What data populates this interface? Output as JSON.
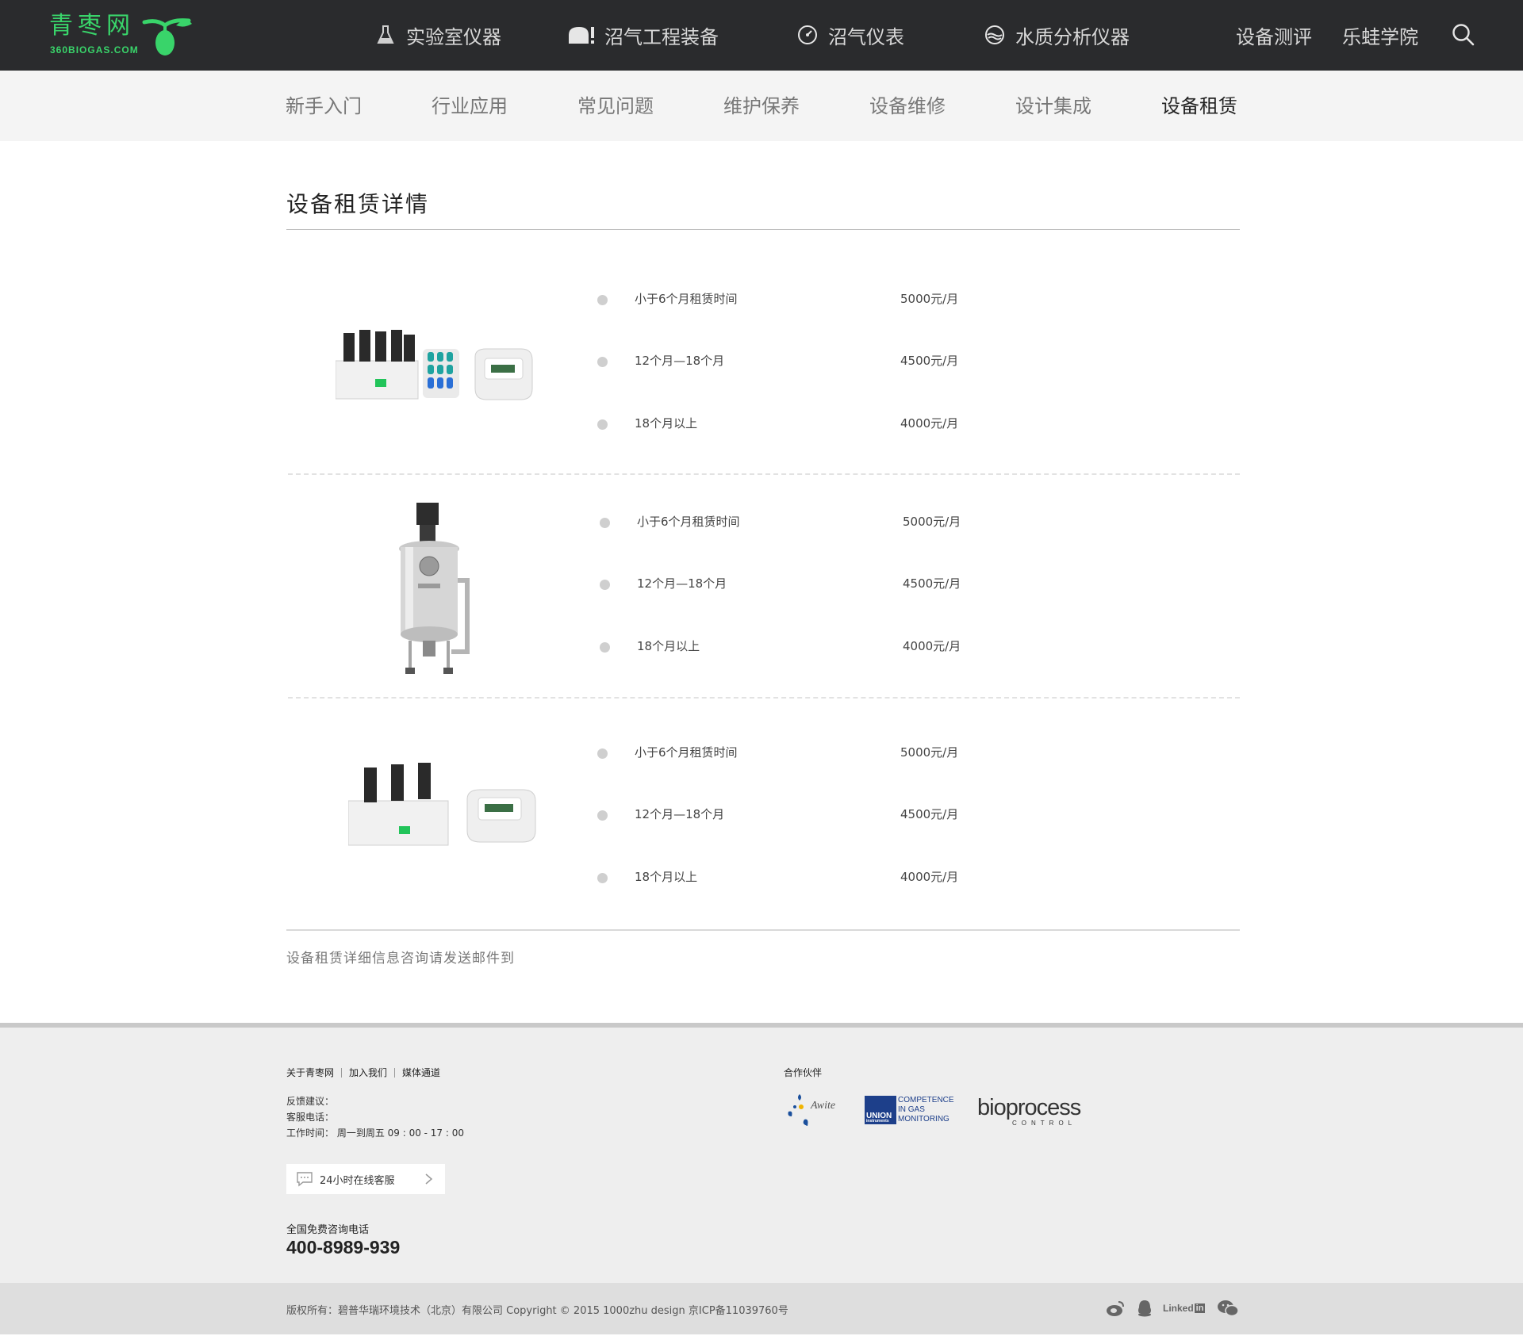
{
  "brand": {
    "name_cn": "青枣网",
    "domain": "360BIOGAS.COM",
    "color": "#39d46a"
  },
  "header": {
    "nav": [
      {
        "label": "实验室仪器",
        "icon": "flask-icon"
      },
      {
        "label": "沼气工程装备",
        "icon": "tank-icon"
      },
      {
        "label": "沼气仪表",
        "icon": "gauge-icon"
      },
      {
        "label": "水质分析仪器",
        "icon": "water-icon"
      }
    ],
    "right_links": [
      "设备测评",
      "乐蛙学院"
    ],
    "search_icon": "search-icon"
  },
  "subnav": {
    "items": [
      "新手入门",
      "行业应用",
      "常见问题",
      "维护保养",
      "设备维修",
      "设计集成",
      "设备租赁"
    ],
    "active_index": 6
  },
  "main": {
    "title": "设备租赁详情",
    "products": [
      {
        "image": "multi-reactor-test-system",
        "rates": [
          {
            "label": "小于6个月租赁时间",
            "price": "5000元/月"
          },
          {
            "label": "12个月—18个月",
            "price": "4500元/月"
          },
          {
            "label": "18个月以上",
            "price": "4000元/月"
          }
        ]
      },
      {
        "image": "stainless-fermenter",
        "rates": [
          {
            "label": "小于6个月租赁时间",
            "price": "5000元/月"
          },
          {
            "label": "12个月—18个月",
            "price": "4500元/月"
          },
          {
            "label": "18个月以上",
            "price": "4000元/月"
          }
        ]
      },
      {
        "image": "three-reactor-test-system",
        "rates": [
          {
            "label": "小于6个月租赁时间",
            "price": "5000元/月"
          },
          {
            "label": "12个月—18个月",
            "price": "4500元/月"
          },
          {
            "label": "18个月以上",
            "price": "4000元/月"
          }
        ]
      }
    ],
    "contact_note": "设备租赁详细信息咨询请发送邮件到"
  },
  "footer": {
    "links": [
      "关于青枣网",
      "加入我们",
      "媒体通道"
    ],
    "feedback_label": "反馈建议：",
    "service_phone_label": "客服电话：",
    "work_hours": "工作时间： 周一到周五 09 : 00 - 17 : 00",
    "chat_button": "24小时在线客服",
    "hotline_label": "全国免费咨询电话",
    "hotline_number": "400-8989-939",
    "partners_title": "合作伙伴",
    "partners": {
      "awite": "Awite",
      "union_logo": "UNION",
      "union_sub": "instruments",
      "union_tagline": [
        "COMPETENCE",
        "IN GAS",
        "MONITORING"
      ],
      "bioprocess": "bioprocess",
      "bioprocess_sub": "CONTROL"
    },
    "copyright": "版权所有：碧普华瑞环境技术（北京）有限公司    Copyright © 2015 1000zhu design 京ICP备11039760号",
    "social": [
      "weibo-icon",
      "qq-icon",
      "linkedin-icon",
      "wechat-icon"
    ],
    "linkedin_text": "Linked",
    "linkedin_box": "in"
  }
}
